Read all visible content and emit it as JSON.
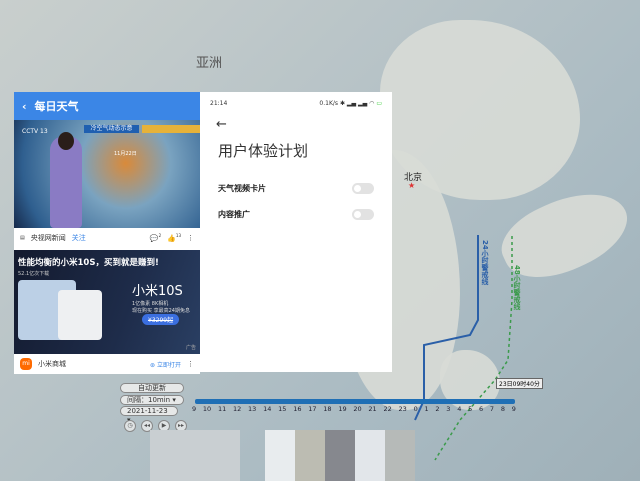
{
  "map": {
    "continent_label": "亚洲",
    "city_label": "北京",
    "alert_24": "24小时警戒线",
    "alert_48": "48小时警戒线",
    "timestamp": "23日09时40分"
  },
  "left_app": {
    "header_title": "每日天气",
    "video": {
      "logo": "CCTV 13",
      "banner": "冷空气动态示意",
      "label": "11月22日"
    },
    "source": {
      "name": "央视网新闻",
      "follow": "关注",
      "comment_count": "2",
      "like_count": "13"
    },
    "ad": {
      "title": "性能均衡的小米10S，买到就是赚到!",
      "sub": "52.1亿次下载",
      "brand": "小米10S",
      "line1": "1亿像素 8K相机",
      "line2": "现在购买 享最高24期免息",
      "price": "¥3299起",
      "tag": "广告"
    },
    "advertiser": {
      "name": "小米商城",
      "action": "立即打开"
    }
  },
  "right_app": {
    "time": "21:14",
    "status": "0.1K/s",
    "title": "用户体验计划",
    "settings": [
      {
        "label": "天气视频卡片",
        "enabled": false
      },
      {
        "label": "内容推广",
        "enabled": false
      }
    ]
  },
  "controls": {
    "auto_update": "自动更新",
    "interval": "间隔：10min",
    "date": "2021-11-23",
    "timeline_labels": [
      "9",
      "10",
      "11",
      "12",
      "13",
      "14",
      "15",
      "16",
      "17",
      "18",
      "19",
      "20",
      "21",
      "22",
      "23",
      "0",
      "1",
      "2",
      "3",
      "4",
      "5",
      "6",
      "7",
      "8",
      "9"
    ]
  }
}
